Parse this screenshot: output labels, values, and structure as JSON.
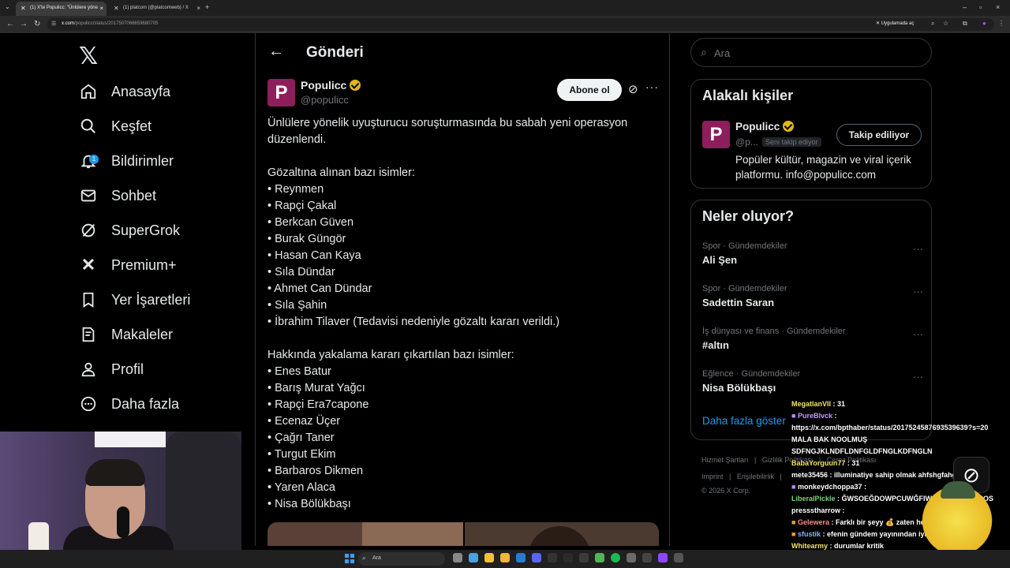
{
  "browser": {
    "tabs": [
      {
        "label": "(1) X'te Populicc: \"Ünlülere yöne",
        "close": "×"
      },
      {
        "label": "(1) platcom (@platcomweb) / X",
        "close": "×"
      }
    ],
    "new_tab": "+",
    "window_controls": [
      "–",
      "▫",
      "×"
    ],
    "url_host": "x.com",
    "url_path": "/populicc/status/2017507066659680705",
    "app_button": "Uygulamada aç"
  },
  "sidebar": {
    "logo": "𝕏",
    "items": [
      {
        "label": "Anasayfa",
        "icon": "home-icon"
      },
      {
        "label": "Keşfet",
        "icon": "search-icon"
      },
      {
        "label": "Bildirimler",
        "icon": "bell-icon",
        "badge": "1"
      },
      {
        "label": "Sohbet",
        "icon": "mail-icon"
      },
      {
        "label": "SuperGrok",
        "icon": "grok-icon"
      },
      {
        "label": "Premium+",
        "icon": "x-premium-icon"
      },
      {
        "label": "Yer İşaretleri",
        "icon": "bookmark-icon"
      },
      {
        "label": "Makaleler",
        "icon": "article-icon"
      },
      {
        "label": "Profil",
        "icon": "person-icon"
      },
      {
        "label": "Daha fazla",
        "icon": "more-circle-icon"
      }
    ]
  },
  "main": {
    "back": "←",
    "title": "Gönderi",
    "author": {
      "name": "Populicc",
      "handle": "@populicc",
      "avatar_letter": "P"
    },
    "subscribe": "Abone ol",
    "more": "···",
    "text": "Ünlülere yönelik uyuşturucu soruşturmasında bu sabah yeni operasyon düzenlendi.\n\nGözaltına alınan bazı isimler:\n• Reynmen\n• Rapçi Çakal\n• Berkcan Güven\n• Burak Güngör\n• Hasan Can Kaya\n• Sıla Dündar\n• Ahmet Can Dündar\n• Sıla Şahin\n• İbrahim Tilaver (Tedavisi nedeniyle gözaltı kararı verildi.)\n\nHakkında yakalama kararı çıkartılan bazı isimler:\n• Enes Batur\n• Barış Murat Yağcı\n• Rapçi Era7capone\n• Ecenaz Üçer\n• Çağrı Taner\n• Turgut Ekim\n• Barbaros Dikmen\n• Yaren Alaca\n• Nisa Bölükbaşı"
  },
  "right": {
    "search_placeholder": "Ara",
    "related": {
      "title": "Alakalı kişiler",
      "name": "Populicc",
      "handle": "@p...",
      "follows_you": "Seni takip ediyor",
      "button": "Takip ediliyor",
      "bio": "Popüler kültür, magazin ve viral içerik platformu. info@populicc.com",
      "avatar_letter": "P"
    },
    "trends": {
      "title": "Neler oluyor?",
      "items": [
        {
          "category": "Spor · Gündemdekiler",
          "topic": "Ali Şen"
        },
        {
          "category": "Spor · Gündemdekiler",
          "topic": "Sadettin Saran"
        },
        {
          "category": "İş dünyası ve finans · Gündemdekiler",
          "topic": "#altın"
        },
        {
          "category": "Eğlence · Gündemdekiler",
          "topic": "Nisa Bölükbaşı"
        }
      ],
      "more_dots": "···",
      "show_more": "Daha fazla göster"
    },
    "footer": {
      "line1": [
        "Hizmet Şartları",
        "|",
        "Gizlilik Politikası",
        "|",
        "Çerez Politikası"
      ],
      "line2": [
        "Imprint",
        "|",
        "Erişilebilirlik",
        "|"
      ],
      "copyright": "© 2026 X Corp."
    }
  },
  "chat": [
    {
      "user": "MegatlanVII",
      "msg": "31"
    },
    {
      "user": "PureBlvck",
      "msg": ""
    },
    {
      "user": "",
      "msg": "https://x.com/bpthaber/status/2017524587693539639?s=20"
    },
    {
      "user": "",
      "msg": "MALA BAK NOOLMUŞ"
    },
    {
      "user": "",
      "msg": "SDFNGJKLNDFLDNFGLDFNGLKDFNGLN"
    },
    {
      "user": "BabaYorguun77",
      "msg": "31"
    },
    {
      "user": "mete35456",
      "msg": "illuminatiye sahip olmak ahfshgfahgfds"
    },
    {
      "user": "monkeydchoppa37",
      "msg": ""
    },
    {
      "user": "LiberalPickle",
      "msg": "ĞWSOEĞDOWPCUWĞFIWPFIWĞOICHĞPOS"
    },
    {
      "user": "pressstharrow",
      "msg": ""
    },
    {
      "user": "Gelewera",
      "msg": "Farklı bir şeyy 💰 zaten hepsi aynı"
    },
    {
      "user": "sfustik",
      "msg": "efenin gündem yayınından iyiymiş yakuptv"
    },
    {
      "user": "Whitearmy",
      "msg": "durumlar kritik"
    }
  ],
  "chat_logo": "⊘",
  "taskbar": {
    "search": "Ara"
  },
  "colors": {
    "accent": "#1d9bf0",
    "brand": "#8e1d5b",
    "verified": "#e2b719",
    "chat_user": "#f2e36b"
  }
}
